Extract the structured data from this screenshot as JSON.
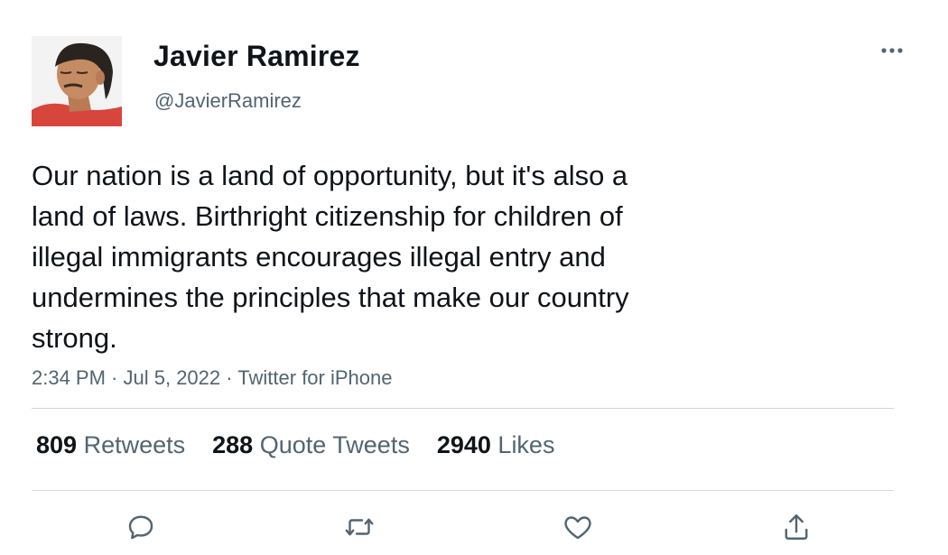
{
  "user": {
    "display_name": "Javier Ramirez",
    "handle": "@JavierRamirez"
  },
  "tweet": {
    "text_lines": [
      "Our nation is a land of opportunity, but it's also a",
      "land of laws. Birthright citizenship for children of",
      "illegal immigrants encourages illegal entry and",
      "undermines the principles that make our country",
      "strong."
    ],
    "time": "2:34 PM",
    "separator": " · ",
    "date": "Jul 5, 2022",
    "source": "Twitter for iPhone"
  },
  "stats": {
    "retweets": {
      "count": "809",
      "label": "Retweets"
    },
    "quote_tweets": {
      "count": "288",
      "label": "Quote Tweets"
    },
    "likes": {
      "count": "2940",
      "label": "Likes"
    }
  },
  "icons": {
    "more": "more-horizontal-icon",
    "reply": "reply-icon",
    "retweet": "retweet-icon",
    "like": "heart-icon",
    "share": "share-icon"
  },
  "colors": {
    "text_primary": "#0f1419",
    "text_secondary": "#536471",
    "divider": "#cfd9de",
    "icon": "#536471"
  }
}
